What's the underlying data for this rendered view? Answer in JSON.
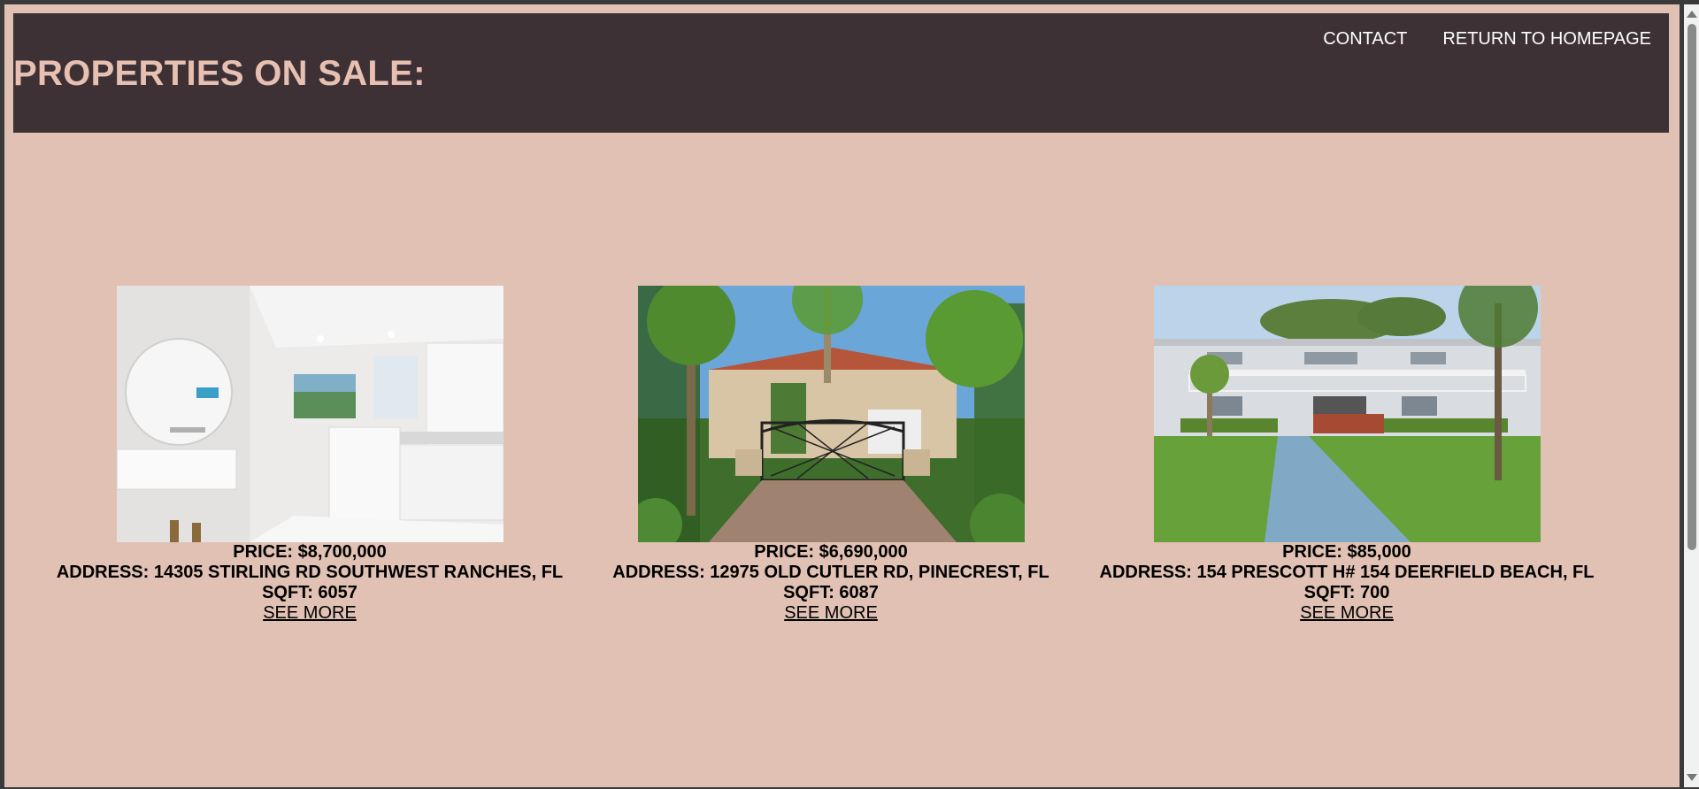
{
  "header": {
    "title": "PROPERTIES ON SALE:",
    "nav": {
      "contact": "CONTACT",
      "home": "RETURN TO HOMEPAGE"
    }
  },
  "listings": [
    {
      "price": "PRICE: $8,700,000",
      "address": "ADDRESS: 14305 STIRLING RD SOUTHWEST RANCHES, FL",
      "sqft": "SQFT: 6057",
      "link": "SEE MORE",
      "image": "kitchen-interior-photo"
    },
    {
      "price": "PRICE: $6,690,000",
      "address": "ADDRESS: 12975 OLD CUTLER RD, PINECREST, FL",
      "sqft": "SQFT: 6087",
      "link": "SEE MORE",
      "image": "gated-villa-photo"
    },
    {
      "price": "PRICE: $85,000",
      "address": "ADDRESS: 154 PRESCOTT H# 154 DEERFIELD BEACH, FL",
      "sqft": "SQFT: 700",
      "link": "SEE MORE",
      "image": "condo-building-photo"
    }
  ],
  "colors": {
    "page_bg": "#e1c1b3",
    "header_bg": "#3e3135",
    "title": "#e7c0b2"
  }
}
